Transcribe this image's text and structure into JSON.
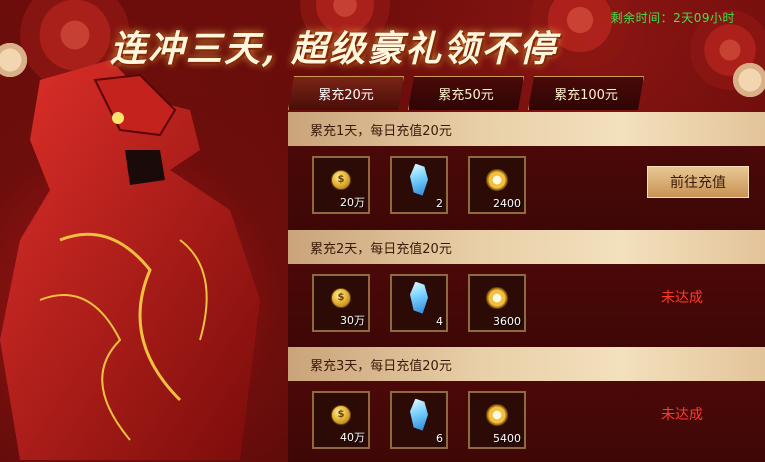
{
  "timer": {
    "label": "剩余时间：2天09小时"
  },
  "title": "连冲三天, 超级豪礼领不停",
  "tabs": [
    {
      "label": "累充20元",
      "active": true
    },
    {
      "label": "累充50元",
      "active": false
    },
    {
      "label": "累充100元",
      "active": false
    }
  ],
  "rows": [
    {
      "heading": "累充1天，每日充值20元",
      "rewards": [
        {
          "icon": "coin-icon",
          "qty": "20万"
        },
        {
          "icon": "gem-icon",
          "qty": "2"
        },
        {
          "icon": "medal-icon",
          "qty": "2400"
        }
      ],
      "action": {
        "type": "button",
        "label": "前往充值"
      }
    },
    {
      "heading": "累充2天，每日充值20元",
      "rewards": [
        {
          "icon": "coin-icon",
          "qty": "30万"
        },
        {
          "icon": "gem-icon",
          "qty": "4"
        },
        {
          "icon": "medal-icon",
          "qty": "3600"
        }
      ],
      "action": {
        "type": "status",
        "label": "未达成"
      }
    },
    {
      "heading": "累充3天，每日充值20元",
      "rewards": [
        {
          "icon": "coin-icon",
          "qty": "40万"
        },
        {
          "icon": "gem-icon",
          "qty": "6"
        },
        {
          "icon": "medal-icon",
          "qty": "5400"
        }
      ],
      "action": {
        "type": "status",
        "label": "未达成"
      }
    }
  ],
  "colors": {
    "timer": "#3fe34b",
    "status": "#ff3a2a",
    "gold": "#c89c5a"
  }
}
